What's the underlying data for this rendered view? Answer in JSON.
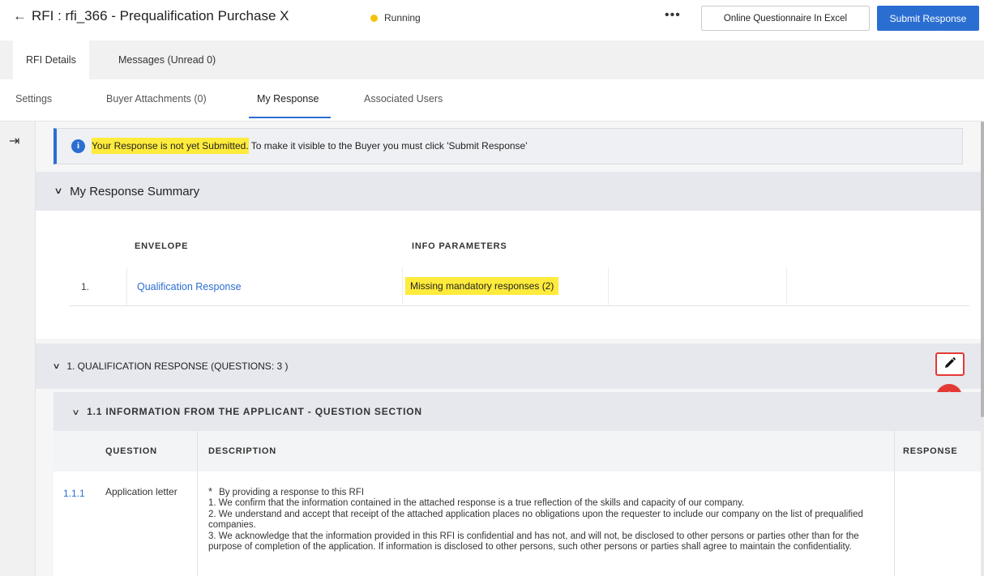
{
  "header": {
    "title": "RFI : rfi_366 - Prequalification Purchase X",
    "status": "Running",
    "more": "•••",
    "excel_button": "Online Questionnaire In Excel",
    "submit_button": "Submit Response",
    "status_color": "#f4c20d",
    "accent_color": "#2b6ed2"
  },
  "tabs_primary": [
    "RFI Details",
    "Messages (Unread 0)"
  ],
  "tabs_secondary": [
    "Settings",
    "Buyer Attachments (0)",
    "My Response",
    "Associated Users"
  ],
  "active_tab": "My Response",
  "info_banner": {
    "highlighted": "Your Response is not yet Submitted.",
    "rest": " To make it visible to the Buyer you must click 'Submit Response'"
  },
  "summary": {
    "title": "My Response Summary",
    "columns": [
      "ENVELOPE",
      "INFO PARAMETERS"
    ],
    "rows": [
      {
        "index": "1.",
        "envelope": "Qualification Response",
        "info": "Missing mandatory responses (2)"
      }
    ]
  },
  "qualification_section": {
    "title": "1. QUALIFICATION RESPONSE (QUESTIONS: 3 )",
    "edit_icon": "pencil-icon",
    "step_badge": "1",
    "subsection_title": "1.1  INFORMATION FROM THE APPLICANT - QUESTION SECTION",
    "columns": [
      "QUESTION",
      "DESCRIPTION",
      "RESPONSE"
    ],
    "questions": [
      {
        "number": "1.1.1",
        "name": "Application letter",
        "description_lines": [
          "By providing a response to this RFI",
          "1. We confirm that the information contained in the attached response is a true reflection of the skills and capacity of our company.",
          "2. We understand and accept that receipt of the attached application places no obligations upon the requester to include our company on the list of prequalified companies.",
          "3. We acknowledge that the information provided in this RFI is confidential and has not, and will not, be disclosed to other persons or parties other than for the purpose of completion of the application. If information is disclosed to other persons, such other persons or parties shall agree to maintain the confidentiality."
        ]
      }
    ]
  }
}
